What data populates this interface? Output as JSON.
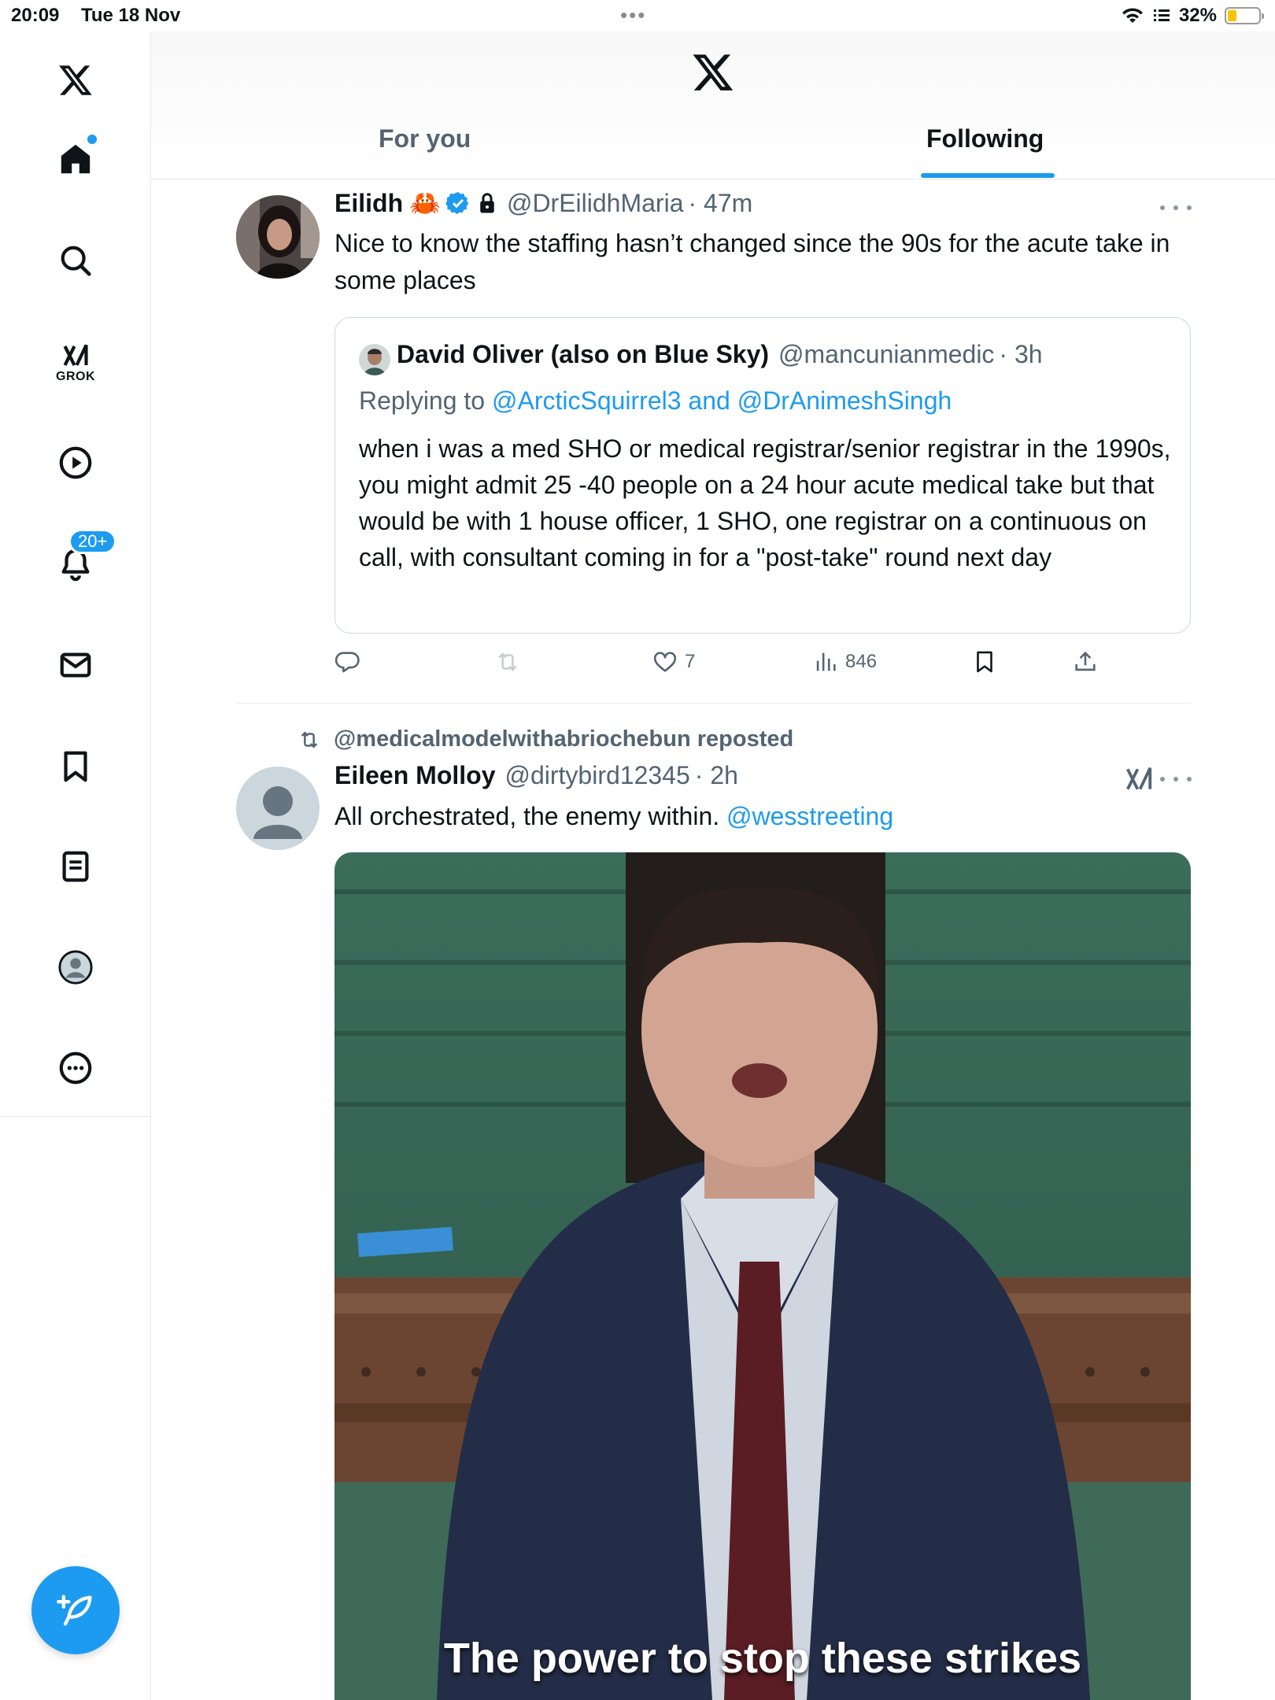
{
  "status_bar": {
    "time": "20:09",
    "date": "Tue 18 Nov",
    "battery": "32%"
  },
  "sidebar": {
    "grok_label": "GROK",
    "notifications_badge": "20+"
  },
  "header": {
    "tabs": [
      {
        "label": "For you",
        "active": false
      },
      {
        "label": "Following",
        "active": true
      }
    ]
  },
  "tweets": [
    {
      "name": "Eilidh",
      "emoji": "🦀",
      "verified": true,
      "protected": true,
      "handle": "@DrEilidhMaria",
      "time": "· 47m",
      "text": "Nice to know the staffing hasn’t changed since the 90s for the acute take in some places",
      "quote": {
        "name": "David Oliver (also on Blue Sky)",
        "handle": "@mancunianmedic",
        "time": "· 3h",
        "replying_prefix": "Replying to ",
        "replying_to": "@ArcticSquirrel3 and @DrAnimeshSingh",
        "text": "when i was a med SHO or medical registrar/senior registrar in the 1990s, you might admit 25 -40 people on a 24 hour acute medical take but that would be with 1 house officer, 1 SHO, one registrar on a continuous on call, with consultant coming in for a \"post-take\" round next day"
      },
      "actions": {
        "likes": "7",
        "views": "846"
      }
    },
    {
      "repost_label": "@medicalmodelwithabriochebun reposted",
      "name": "Eileen Molloy",
      "handle": "@dirtybird12345",
      "time": "· 2h",
      "text_main": "All orchestrated, the enemy within. ",
      "text_mention": "@wesstreeting",
      "media_caption": "The power to stop these strikes"
    }
  ],
  "colors": {
    "accent": "#1d9bf0",
    "text": "#0f1419",
    "secondary": "#536471"
  }
}
